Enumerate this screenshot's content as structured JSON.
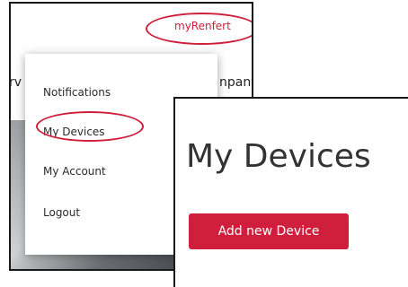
{
  "header": {
    "account_link": "myRenfert"
  },
  "background": {
    "left_text": "rv",
    "right_text": "npany"
  },
  "dropdown": {
    "items": [
      {
        "label": "Notifications"
      },
      {
        "label": "My Devices"
      },
      {
        "label": "My Account"
      },
      {
        "label": "Logout"
      }
    ]
  },
  "devices_page": {
    "title": "My Devices",
    "add_button_label": "Add new Device"
  },
  "colors": {
    "accent": "#d01f3c",
    "highlight_ring": "#d01f3c",
    "text": "#2a2a2a"
  }
}
